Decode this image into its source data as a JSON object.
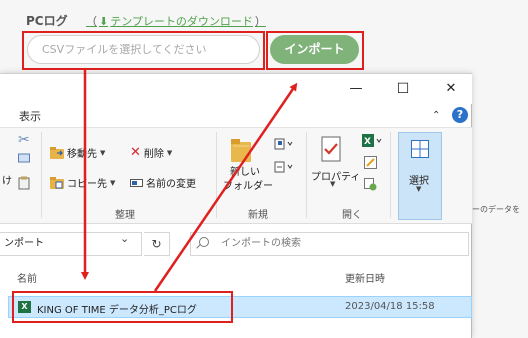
{
  "page": {
    "title": "PCログ",
    "template_link": "テンプレートのダウンロード",
    "template_paren_open": "（",
    "template_paren_close": "）",
    "csv_placeholder": "CSVファイルを選択してください",
    "import_label": "インポート",
    "side_text": "ーのデータを"
  },
  "window": {
    "menu_view": "表示",
    "minimize": "—",
    "maximize": "☐",
    "close": "✕",
    "ribbon": {
      "move_to": "移動先",
      "copy_to": "コピー先",
      "delete": "削除",
      "rename": "名前の変更",
      "new_folder_l1": "新しい",
      "new_folder_l2": "フォルダー",
      "properties": "プロパティ",
      "select": "選択",
      "group_organize": "整理",
      "group_new": "新規",
      "group_open": "開く",
      "left_partial": "け"
    },
    "address": {
      "path": "ンポート",
      "search_placeholder": "インポートの検索"
    },
    "columns": {
      "name": "名前",
      "date": "更新日時"
    },
    "files": [
      {
        "name": "KING OF TIME データ分析_PCログ",
        "date": "2023/04/18 15:58",
        "icon": "excel-icon"
      }
    ]
  },
  "colors": {
    "accent_green": "#7fb37a",
    "link_green": "#4fa14a",
    "highlight_red": "#e0201f",
    "selection_blue": "#cce8ff"
  }
}
